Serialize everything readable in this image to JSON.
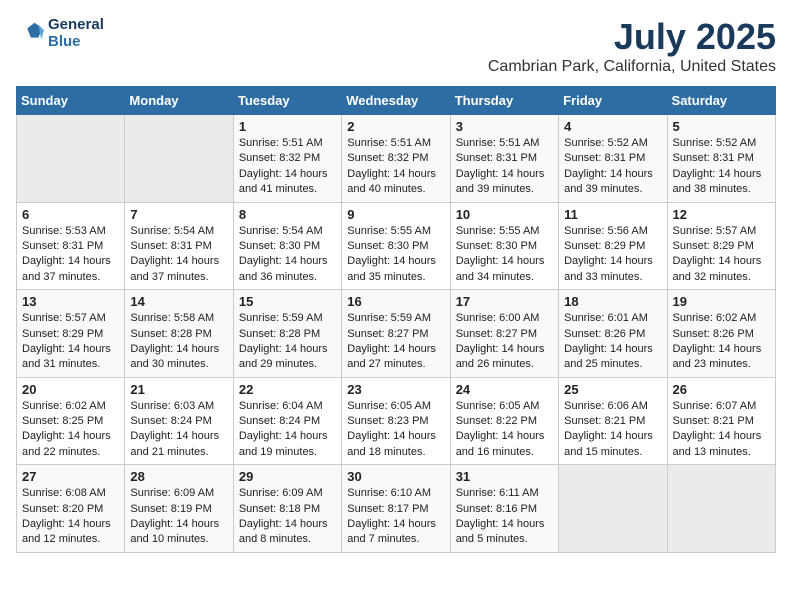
{
  "logo": {
    "line1": "General",
    "line2": "Blue"
  },
  "title": "July 2025",
  "location": "Cambrian Park, California, United States",
  "weekdays": [
    "Sunday",
    "Monday",
    "Tuesday",
    "Wednesday",
    "Thursday",
    "Friday",
    "Saturday"
  ],
  "weeks": [
    [
      {
        "day": "",
        "info": ""
      },
      {
        "day": "",
        "info": ""
      },
      {
        "day": "1",
        "info": "Sunrise: 5:51 AM\nSunset: 8:32 PM\nDaylight: 14 hours and 41 minutes."
      },
      {
        "day": "2",
        "info": "Sunrise: 5:51 AM\nSunset: 8:32 PM\nDaylight: 14 hours and 40 minutes."
      },
      {
        "day": "3",
        "info": "Sunrise: 5:51 AM\nSunset: 8:31 PM\nDaylight: 14 hours and 39 minutes."
      },
      {
        "day": "4",
        "info": "Sunrise: 5:52 AM\nSunset: 8:31 PM\nDaylight: 14 hours and 39 minutes."
      },
      {
        "day": "5",
        "info": "Sunrise: 5:52 AM\nSunset: 8:31 PM\nDaylight: 14 hours and 38 minutes."
      }
    ],
    [
      {
        "day": "6",
        "info": "Sunrise: 5:53 AM\nSunset: 8:31 PM\nDaylight: 14 hours and 37 minutes."
      },
      {
        "day": "7",
        "info": "Sunrise: 5:54 AM\nSunset: 8:31 PM\nDaylight: 14 hours and 37 minutes."
      },
      {
        "day": "8",
        "info": "Sunrise: 5:54 AM\nSunset: 8:30 PM\nDaylight: 14 hours and 36 minutes."
      },
      {
        "day": "9",
        "info": "Sunrise: 5:55 AM\nSunset: 8:30 PM\nDaylight: 14 hours and 35 minutes."
      },
      {
        "day": "10",
        "info": "Sunrise: 5:55 AM\nSunset: 8:30 PM\nDaylight: 14 hours and 34 minutes."
      },
      {
        "day": "11",
        "info": "Sunrise: 5:56 AM\nSunset: 8:29 PM\nDaylight: 14 hours and 33 minutes."
      },
      {
        "day": "12",
        "info": "Sunrise: 5:57 AM\nSunset: 8:29 PM\nDaylight: 14 hours and 32 minutes."
      }
    ],
    [
      {
        "day": "13",
        "info": "Sunrise: 5:57 AM\nSunset: 8:29 PM\nDaylight: 14 hours and 31 minutes."
      },
      {
        "day": "14",
        "info": "Sunrise: 5:58 AM\nSunset: 8:28 PM\nDaylight: 14 hours and 30 minutes."
      },
      {
        "day": "15",
        "info": "Sunrise: 5:59 AM\nSunset: 8:28 PM\nDaylight: 14 hours and 29 minutes."
      },
      {
        "day": "16",
        "info": "Sunrise: 5:59 AM\nSunset: 8:27 PM\nDaylight: 14 hours and 27 minutes."
      },
      {
        "day": "17",
        "info": "Sunrise: 6:00 AM\nSunset: 8:27 PM\nDaylight: 14 hours and 26 minutes."
      },
      {
        "day": "18",
        "info": "Sunrise: 6:01 AM\nSunset: 8:26 PM\nDaylight: 14 hours and 25 minutes."
      },
      {
        "day": "19",
        "info": "Sunrise: 6:02 AM\nSunset: 8:26 PM\nDaylight: 14 hours and 23 minutes."
      }
    ],
    [
      {
        "day": "20",
        "info": "Sunrise: 6:02 AM\nSunset: 8:25 PM\nDaylight: 14 hours and 22 minutes."
      },
      {
        "day": "21",
        "info": "Sunrise: 6:03 AM\nSunset: 8:24 PM\nDaylight: 14 hours and 21 minutes."
      },
      {
        "day": "22",
        "info": "Sunrise: 6:04 AM\nSunset: 8:24 PM\nDaylight: 14 hours and 19 minutes."
      },
      {
        "day": "23",
        "info": "Sunrise: 6:05 AM\nSunset: 8:23 PM\nDaylight: 14 hours and 18 minutes."
      },
      {
        "day": "24",
        "info": "Sunrise: 6:05 AM\nSunset: 8:22 PM\nDaylight: 14 hours and 16 minutes."
      },
      {
        "day": "25",
        "info": "Sunrise: 6:06 AM\nSunset: 8:21 PM\nDaylight: 14 hours and 15 minutes."
      },
      {
        "day": "26",
        "info": "Sunrise: 6:07 AM\nSunset: 8:21 PM\nDaylight: 14 hours and 13 minutes."
      }
    ],
    [
      {
        "day": "27",
        "info": "Sunrise: 6:08 AM\nSunset: 8:20 PM\nDaylight: 14 hours and 12 minutes."
      },
      {
        "day": "28",
        "info": "Sunrise: 6:09 AM\nSunset: 8:19 PM\nDaylight: 14 hours and 10 minutes."
      },
      {
        "day": "29",
        "info": "Sunrise: 6:09 AM\nSunset: 8:18 PM\nDaylight: 14 hours and 8 minutes."
      },
      {
        "day": "30",
        "info": "Sunrise: 6:10 AM\nSunset: 8:17 PM\nDaylight: 14 hours and 7 minutes."
      },
      {
        "day": "31",
        "info": "Sunrise: 6:11 AM\nSunset: 8:16 PM\nDaylight: 14 hours and 5 minutes."
      },
      {
        "day": "",
        "info": ""
      },
      {
        "day": "",
        "info": ""
      }
    ]
  ]
}
